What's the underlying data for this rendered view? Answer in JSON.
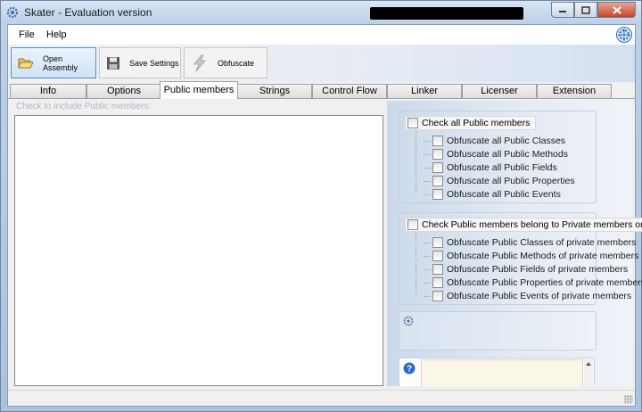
{
  "window": {
    "title": "Skater - Evaluation version"
  },
  "menu": {
    "file": "File",
    "help": "Help"
  },
  "toolbar": {
    "open_assembly": "Open Assembly",
    "save_settings": "Save Settings",
    "obfuscate": "Obfuscate"
  },
  "tabs": [
    "Info",
    "Options",
    "Public members",
    "Strings",
    "Control Flow",
    "Linker",
    "Licenser",
    "Extension"
  ],
  "selected_tab": "Public members",
  "main": {
    "hint": "Check to include Public members:"
  },
  "group_all": {
    "header": "Check all Public members",
    "items": [
      "Obfuscate all Public Classes",
      "Obfuscate all Public Methods",
      "Obfuscate all Public Fields",
      "Obfuscate all Public Properties",
      "Obfuscate all Public Events"
    ]
  },
  "group_private": {
    "header": "Check Public members belong to Private members only",
    "items": [
      "Obfuscate Public Classes of private members",
      "Obfuscate Public Methods of private members",
      "Obfuscate Public Fields of private members",
      "Obfuscate Public Properties of private members",
      "Obfuscate Public Events of private members"
    ]
  },
  "icons": {
    "app": "gear-icon",
    "open": "folder-open-icon",
    "save": "floppy-disk-icon",
    "obfuscate": "lightning-icon",
    "help": "question-icon"
  },
  "colors": {
    "title_bar": "#bcd0e8",
    "selected_toolbar": "#cfe2f6",
    "close_button": "#c7452a",
    "hint_text": "#a9b7c8"
  }
}
